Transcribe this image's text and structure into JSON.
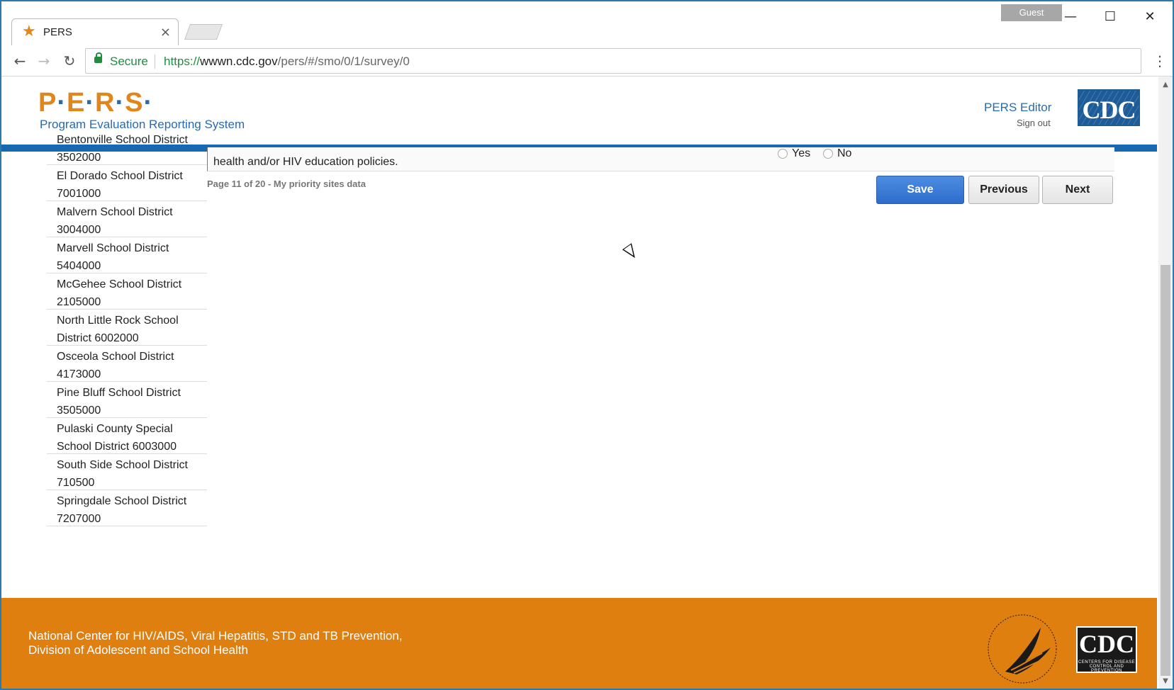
{
  "browser": {
    "tab_title": "PERS",
    "tab_close": "×",
    "guest_label": "Guest",
    "window_buttons": {
      "minimize": "—",
      "maximize": "☐",
      "close": "✕"
    },
    "nav": {
      "back": "←",
      "forward": "→",
      "reload": "↻",
      "menu": "⋮"
    },
    "secure_label": "Secure",
    "url_scheme": "https://",
    "url_host": "wwwn.cdc.gov",
    "url_path": "/pers/#/smo/0/1/survey/0"
  },
  "header": {
    "logo_letters": [
      "P",
      "E",
      "R",
      "S"
    ],
    "logo_subtitle": "Program Evaluation Reporting System",
    "user_label": "PERS Editor",
    "signout_label": "Sign out",
    "cdc_logo_text": "CDC"
  },
  "sidebar": {
    "items": [
      {
        "label": "Bentonville School District\n3502000"
      },
      {
        "label": "El Dorado School District\n7001000"
      },
      {
        "label": "Malvern School District\n3004000"
      },
      {
        "label": "Marvell School District\n5404000"
      },
      {
        "label": "McGehee School District\n2105000"
      },
      {
        "label": "North Little Rock School\nDistrict 6002000"
      },
      {
        "label": "Osceola School District\n4173000"
      },
      {
        "label": "Pine Bluff School District\n3505000"
      },
      {
        "label": "Pulaski County Special\nSchool District 6003000"
      },
      {
        "label": "South Side School District\n710500"
      },
      {
        "label": "Springdale School District\n7207000"
      }
    ]
  },
  "question": {
    "text": "health and/or HIV education policies.",
    "options": [
      "Yes",
      "No"
    ]
  },
  "page_info": "Page 11 of 20 - My priority sites data",
  "buttons": {
    "save": "Save",
    "previous": "Previous",
    "next": "Next"
  },
  "footer": {
    "line1": "National Center for HIV/AIDS, Viral Hepatitis, STD and TB Prevention,",
    "line2": "Division of Adolescent and School Health",
    "cdc_text": "CDC",
    "cdc_small": "CENTERS FOR DISEASE CONTROL AND PREVENTION"
  },
  "colors": {
    "brand_orange": "#df7f10",
    "brand_blue": "#1668b0",
    "save_blue": "#2e6ccc"
  }
}
